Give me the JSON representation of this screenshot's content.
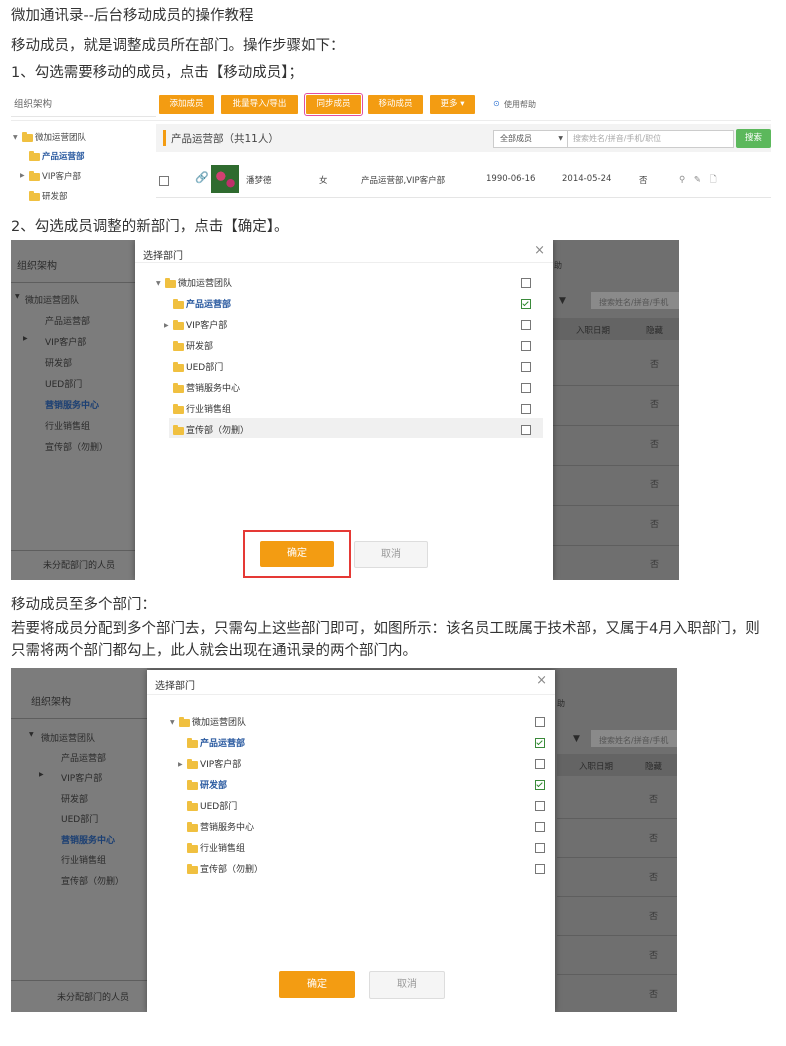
{
  "doc": {
    "title": "微加通讯录--后台移动成员的操作教程",
    "intro": "移动成员，就是调整成员所在部门。操作步骤如下：",
    "step1": "1、勾选需要移动的成员，点击【移动成员】；",
    "step2": "2、勾选成员调整的新部门，点击【确定】。",
    "multi_title": "移动成员至多个部门：",
    "multi_desc": "若要将成员分配到多个部门去，只需勾上这些部门即可，如图所示：该名员工既属于技术部，又属于4月入职部门，则只需将两个部门都勾上，此人就会出现在通讯录的两个部门内。"
  },
  "shot1": {
    "sidebar_title": "组织架构",
    "toolbar": [
      "添加成员",
      "批量导入/导出",
      "同步成员",
      "移动成员",
      "更多 ▾"
    ],
    "help": "使用帮助",
    "tree": [
      "微加运营团队",
      "产品运营部",
      "VIP客户部",
      "研发部"
    ],
    "group_title": "产品运营部（共11人）",
    "filter": "全部成员",
    "search_placeholder": "搜索姓名/拼音/手机/职位",
    "search_btn": "搜索",
    "row": {
      "name": "潘梦德",
      "gender": "女",
      "depts": "产品运营部,VIP客户部",
      "birthday": "1990-06-16",
      "join": "2014-05-24",
      "hidden": "否",
      "icons": "⚲ ✎ 🗋"
    }
  },
  "shot2": {
    "sidebar_title": "组织架构",
    "bg_tree": [
      "微加运营团队",
      "产品运营部",
      "VIP客户部",
      "研发部",
      "UED部门",
      "营销服务中心",
      "行业销售组",
      "宣传部（勿删）"
    ],
    "bottom": "未分配部门的人员",
    "bg_right": {
      "help": "助",
      "search_placeholder": "搜索姓名/拼音/手机",
      "col_join": "入职日期",
      "col_hidden": "隐藏",
      "hidden_vals": [
        "否",
        "否",
        "否",
        "否",
        "否",
        "否"
      ]
    },
    "dialog": {
      "title": "选择部门",
      "close": "×",
      "items": [
        "微加运营团队",
        "产品运营部",
        "VIP客户部",
        "研发部",
        "UED部门",
        "营销服务中心",
        "行业销售组",
        "宣传部（勿删）"
      ],
      "ok": "确定",
      "cancel": "取消"
    }
  },
  "shot3": {
    "sidebar_title": "组织架构",
    "bg_tree": [
      "微加运营团队",
      "产品运营部",
      "VIP客户部",
      "研发部",
      "UED部门",
      "营销服务中心",
      "行业销售组",
      "宣传部（勿删）"
    ],
    "bottom": "未分配部门的人员",
    "bg_right": {
      "help": "助",
      "search_placeholder": "搜索姓名/拼音/手机",
      "col_join": "入职日期",
      "col_hidden": "隐藏",
      "hidden_vals": [
        "否",
        "否",
        "否",
        "否",
        "否",
        "否"
      ]
    },
    "dialog": {
      "title": "选择部门",
      "close": "×",
      "items": [
        "微加运营团队",
        "产品运营部",
        "VIP客户部",
        "研发部",
        "UED部门",
        "营销服务中心",
        "行业销售组",
        "宣传部（勿删）"
      ],
      "ok": "确定",
      "cancel": "取消"
    }
  }
}
